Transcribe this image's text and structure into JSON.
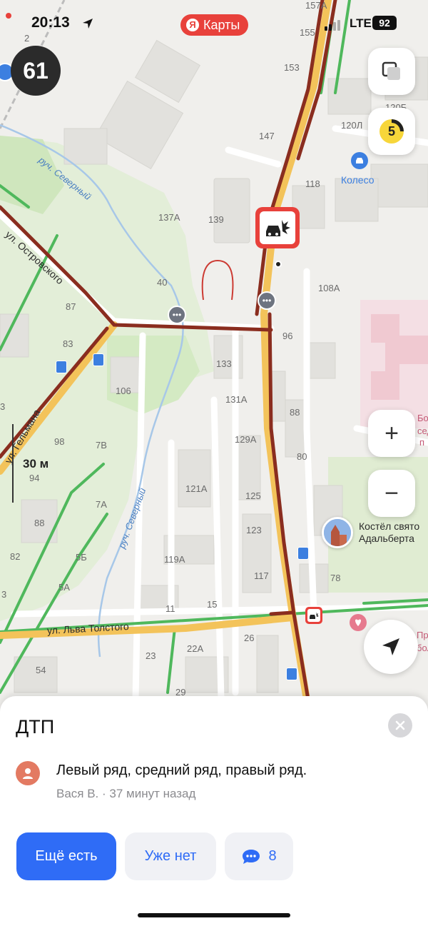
{
  "status": {
    "time": "20:13",
    "network": "LTE",
    "battery": "92"
  },
  "brand": {
    "name": "Карты",
    "logo_letter": "Я"
  },
  "map": {
    "speed_limit": "61",
    "traffic_score": "5",
    "scale": "30 м",
    "streets": [
      "ул. Островского",
      "ул. Гельмана",
      "ул. Льва Толстого"
    ],
    "creeks": [
      "руч. Северный",
      "руч. Северный"
    ],
    "pois": {
      "kolesso": "Колесо",
      "church_line1": "Костёл свято",
      "church_line2": "Адальберта",
      "hospital_a": "Больн",
      "hospital_b": "сед",
      "hospital_c": "п",
      "hospital2_a": "Пр",
      "hospital2_b": "боль"
    },
    "house_numbers": [
      "157А",
      "155",
      "153",
      "147",
      "120Л",
      "120Б",
      "118",
      "137А",
      "139",
      "40",
      "108А",
      "87",
      "96",
      "83",
      "133",
      "106",
      "131А",
      "88",
      "98",
      "7В",
      "129А",
      "80",
      "94",
      "121А",
      "125",
      "7А",
      "88",
      "123",
      "5Б",
      "119А",
      "117",
      "78",
      "82",
      "5А",
      "11",
      "15",
      "3",
      "26",
      "22А",
      "23",
      "54",
      "29",
      "2",
      "3"
    ],
    "controls": {
      "zoom_in": "+",
      "zoom_out": "−"
    }
  },
  "incident": {
    "title": "ДТП",
    "message": "Левый ряд, средний ряд, правый ряд.",
    "meta": "Вася В. · 37 минут назад",
    "confirm_button": "Ещё есть",
    "dismiss_button": "Уже нет",
    "comments_count": "8"
  },
  "colors": {
    "accent": "#2f6cf6",
    "jam_red": "#8a2d1f",
    "slow_yellow": "#f3c35a",
    "free_green": "#4fb85c",
    "incident_red": "#e8413b"
  }
}
